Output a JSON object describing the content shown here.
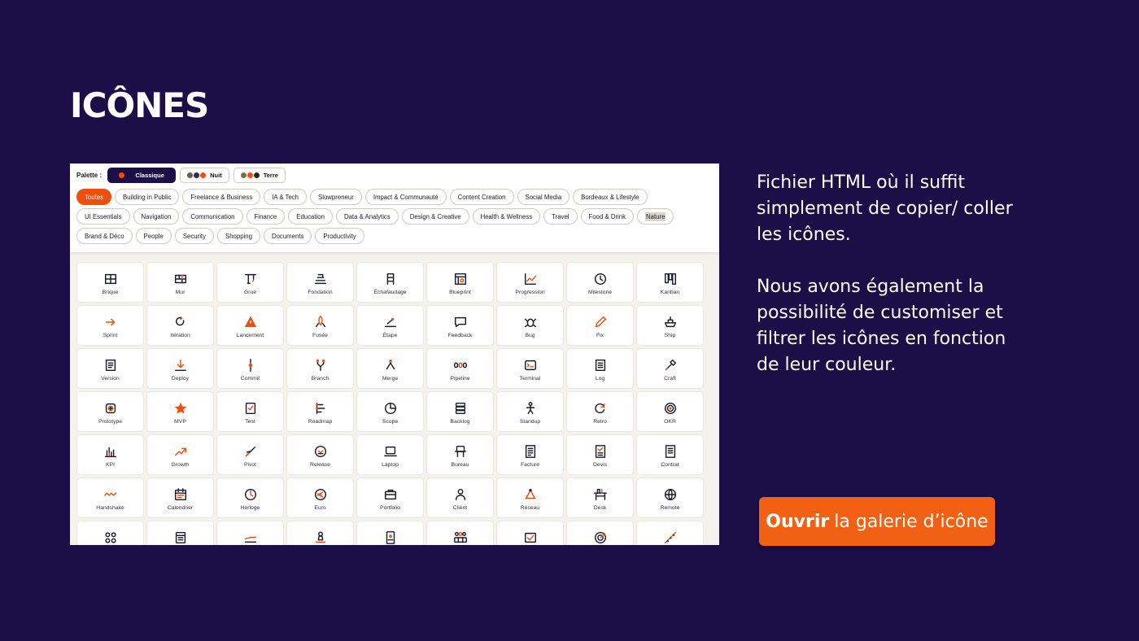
{
  "slide": {
    "title": "ICÔNES",
    "description_1": "Fichier HTML où il suffit simplement de copier/ coller les icônes.",
    "description_2": "Nous avons également la possibilité de customiser et filtrer les icônes en fonction de leur couleur.",
    "cta_strong": "Ouvrir",
    "cta_rest": "la galerie d’icône"
  },
  "colors": {
    "background": "#1c0e46",
    "accent": "#f04e0d",
    "cta": "#f26113",
    "ink": "#1a1a2e"
  },
  "palette": {
    "label": "Palette :",
    "options": [
      {
        "label": "Classique",
        "active": true,
        "dots": [
          "#f04e0d"
        ]
      },
      {
        "label": "Nuit",
        "active": false,
        "dots": [
          "#6b5a44",
          "#2a2a55",
          "#f04e0d"
        ]
      },
      {
        "label": "Terre",
        "active": false,
        "dots": [
          "#7a6a58",
          "#f04e0d",
          "#222222"
        ]
      }
    ]
  },
  "filters": {
    "row1": [
      "Toutes",
      "Building in Public",
      "Freelance & Business",
      "IA & Tech",
      "Slowpreneur",
      "Impact & Communauté",
      "Content Creation",
      "Social Media",
      "Bordeaux & Lifestyle"
    ],
    "row2": [
      "UI Essentials",
      "Navigation",
      "Communication",
      "Finance",
      "Education",
      "Data & Analytics",
      "Design & Creative",
      "Health & Wellness",
      "Travel",
      "Food & Drink",
      "Nature"
    ],
    "row3": [
      "Brand & Déco",
      "People",
      "Security",
      "Shopping",
      "Documents",
      "Productivity"
    ],
    "active": "Toutes",
    "highlighted": "Nature"
  },
  "icons": [
    {
      "label": "Brique",
      "icon": "brick-icon"
    },
    {
      "label": "Mur",
      "icon": "wall-icon"
    },
    {
      "label": "Grue",
      "icon": "crane-icon"
    },
    {
      "label": "Fondation",
      "icon": "foundation-icon"
    },
    {
      "label": "Échafaudage",
      "icon": "scaffold-icon"
    },
    {
      "label": "Blueprint",
      "icon": "blueprint-icon"
    },
    {
      "label": "Progression",
      "icon": "progression-icon"
    },
    {
      "label": "Milestone",
      "icon": "milestone-icon"
    },
    {
      "label": "Kanban",
      "icon": "kanban-icon"
    },
    {
      "label": "Sprint",
      "icon": "sprint-icon"
    },
    {
      "label": "Itération",
      "icon": "iteration-icon"
    },
    {
      "label": "Lancement",
      "icon": "launch-icon"
    },
    {
      "label": "Fusée",
      "icon": "rocket-icon"
    },
    {
      "label": "Étape",
      "icon": "step-icon"
    },
    {
      "label": "Feedback",
      "icon": "feedback-icon"
    },
    {
      "label": "Bug",
      "icon": "bug-icon"
    },
    {
      "label": "Fix",
      "icon": "fix-icon"
    },
    {
      "label": "Ship",
      "icon": "ship-icon"
    },
    {
      "label": "Version",
      "icon": "version-icon"
    },
    {
      "label": "Deploy",
      "icon": "deploy-icon"
    },
    {
      "label": "Commit",
      "icon": "commit-icon"
    },
    {
      "label": "Branch",
      "icon": "branch-icon"
    },
    {
      "label": "Merge",
      "icon": "merge-icon"
    },
    {
      "label": "Pipeline",
      "icon": "pipeline-icon"
    },
    {
      "label": "Terminal",
      "icon": "terminal-icon"
    },
    {
      "label": "Log",
      "icon": "log-icon"
    },
    {
      "label": "Craft",
      "icon": "craft-icon"
    },
    {
      "label": "Prototype",
      "icon": "prototype-icon"
    },
    {
      "label": "MVP",
      "icon": "star-icon"
    },
    {
      "label": "Test",
      "icon": "test-icon"
    },
    {
      "label": "Roadmap",
      "icon": "roadmap-icon"
    },
    {
      "label": "Scope",
      "icon": "scope-icon"
    },
    {
      "label": "Backlog",
      "icon": "backlog-icon"
    },
    {
      "label": "Standup",
      "icon": "standup-icon"
    },
    {
      "label": "Retro",
      "icon": "retro-icon"
    },
    {
      "label": "OKR",
      "icon": "okr-icon"
    },
    {
      "label": "KPI",
      "icon": "kpi-icon"
    },
    {
      "label": "Growth",
      "icon": "growth-icon"
    },
    {
      "label": "Pivot",
      "icon": "pivot-icon"
    },
    {
      "label": "Release",
      "icon": "release-icon"
    },
    {
      "label": "Laptop",
      "icon": "laptop-icon"
    },
    {
      "label": "Bureau",
      "icon": "desk-chair-icon"
    },
    {
      "label": "Facture",
      "icon": "invoice-icon"
    },
    {
      "label": "Devis",
      "icon": "quote-icon"
    },
    {
      "label": "Contrat",
      "icon": "contract-icon"
    },
    {
      "label": "Handshake",
      "icon": "handshake-icon"
    },
    {
      "label": "Calendrier",
      "icon": "calendar-icon"
    },
    {
      "label": "Horloge",
      "icon": "clock-icon"
    },
    {
      "label": "Euro",
      "icon": "euro-icon"
    },
    {
      "label": "Portfolio",
      "icon": "portfolio-icon"
    },
    {
      "label": "Client",
      "icon": "client-icon"
    },
    {
      "label": "Réseau",
      "icon": "network-icon"
    },
    {
      "label": "Desk",
      "icon": "desk-icon"
    },
    {
      "label": "Remote",
      "icon": "globe-icon"
    },
    {
      "label": "",
      "icon": "grid-dots-icon"
    },
    {
      "label": "",
      "icon": "notebook-icon"
    },
    {
      "label": "",
      "icon": "wave-chart-icon"
    },
    {
      "label": "",
      "icon": "stamp-icon"
    },
    {
      "label": "",
      "icon": "id-card-icon"
    },
    {
      "label": "",
      "icon": "team-icon"
    },
    {
      "label": "",
      "icon": "check-box-icon"
    },
    {
      "label": "",
      "icon": "target-icon"
    },
    {
      "label": "",
      "icon": "line-icon"
    }
  ]
}
